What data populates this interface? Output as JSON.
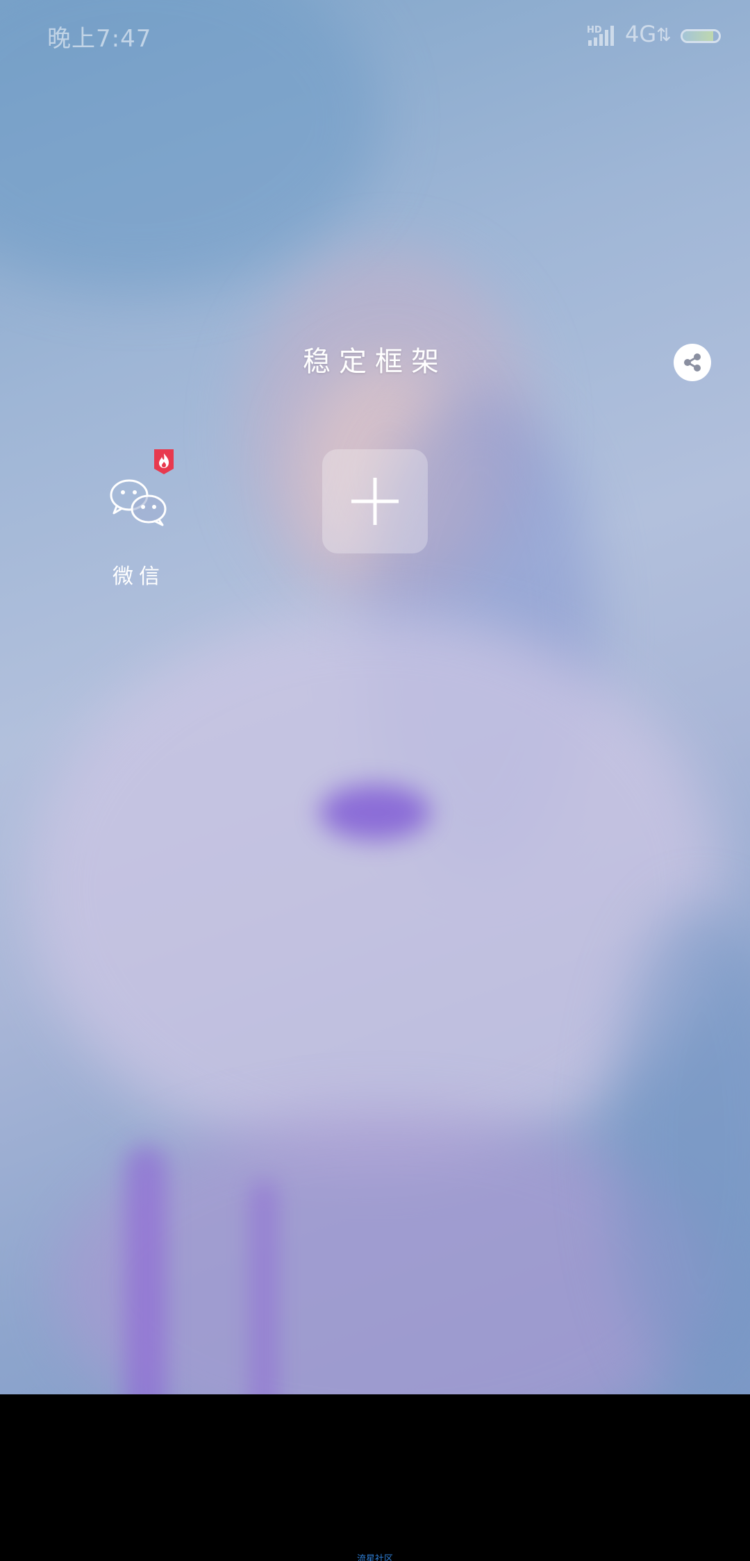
{
  "status_bar": {
    "time": "晚上7:47",
    "hd_label": "HD",
    "network": "4G",
    "battery_level": 0.85
  },
  "widget": {
    "title": "稳定框架"
  },
  "apps": [
    {
      "label": "微信",
      "icon": "wechat-icon",
      "badge_icon": "fire-badge-icon"
    }
  ],
  "footer": {
    "label": "流星社区"
  },
  "colors": {
    "badge": "#e8394e",
    "footer_text": "#2f7fd6",
    "bottom_bar": "#000000"
  }
}
